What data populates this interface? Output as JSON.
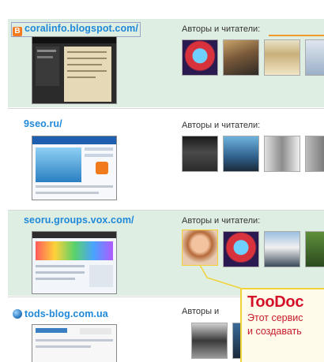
{
  "authors_label": "Авторы и читатели:",
  "rows": [
    {
      "site": "coralinfo.blogspot.com/",
      "icon": "blogger-icon",
      "authors": "Авторы и читатели:"
    },
    {
      "site": "9seo.ru/",
      "icon": "",
      "authors": "Авторы и читатели:"
    },
    {
      "site": "seoru.groups.vox.com/",
      "icon": "",
      "authors": "Авторы и читатели:"
    },
    {
      "site": "tods-blog.com.ua",
      "icon": "globe-icon",
      "authors": "Авторы и"
    }
  ],
  "callout": {
    "title": "TooDoc",
    "line1": "Этот сервис",
    "line2": "и создавать"
  },
  "colors": {
    "link": "#1f88d8",
    "row_green": "#dfeee3",
    "callout_title": "#d5112a",
    "callout_border": "#f2d23a",
    "accent_line": "#f09a2a"
  }
}
